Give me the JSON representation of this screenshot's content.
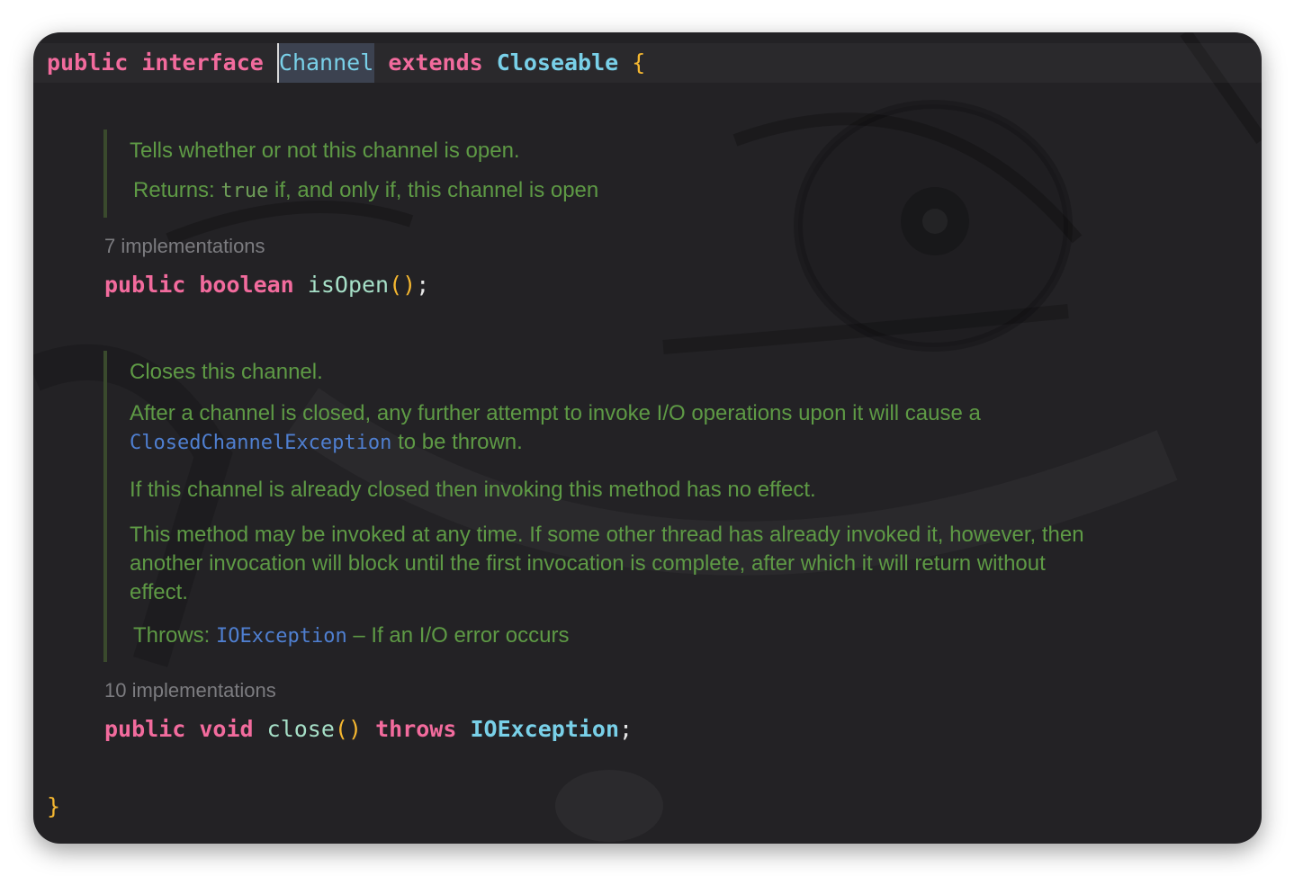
{
  "editor": {
    "colors": {
      "keyword": "#f26b9d",
      "type": "#79d0e8",
      "method": "#a6dfc7",
      "brace": "#f5b730",
      "doc_text": "#5e9a45",
      "doc_link": "#4f7fd0",
      "hint": "#7c7c80",
      "background": "#232225"
    },
    "declaration": {
      "kw_public": "public",
      "kw_interface": "interface",
      "name": "Channel",
      "kw_extends": "extends",
      "parent": "Closeable",
      "open_brace": "{"
    },
    "doc_is_open": {
      "summary": "Tells whether or not this channel is open.",
      "returns_label": "Returns:",
      "returns_code": "true",
      "returns_text": " if, and only if, this channel is open"
    },
    "is_open": {
      "implementations": "7 implementations",
      "kw_public": "public",
      "kw_type": "boolean",
      "method": "isOpen",
      "parens": "()",
      "semicolon": ";"
    },
    "doc_close": {
      "summary": "Closes this channel.",
      "para1_text": "After a channel is closed, any further attempt to invoke I/O operations upon it will cause a",
      "para1_link": "ClosedChannelException",
      "para1_tail": " to be thrown.",
      "para2": "If this channel is already closed then invoking this method has no effect.",
      "para3_line1": "This method may be invoked at any time. If some other thread has already invoked it, however, then",
      "para3_line2": "another invocation will block until the first invocation is complete, after which it will return without",
      "para3_line3": "effect.",
      "throws_label": "Throws:",
      "throws_link": "IOException",
      "throws_text": " – If an I/O error occurs"
    },
    "close": {
      "implementations": "10 implementations",
      "kw_public": "public",
      "kw_void": "void",
      "method": "close",
      "parens": "()",
      "kw_throws": "throws",
      "exception": "IOException",
      "semicolon": ";"
    },
    "close_brace": "}"
  }
}
